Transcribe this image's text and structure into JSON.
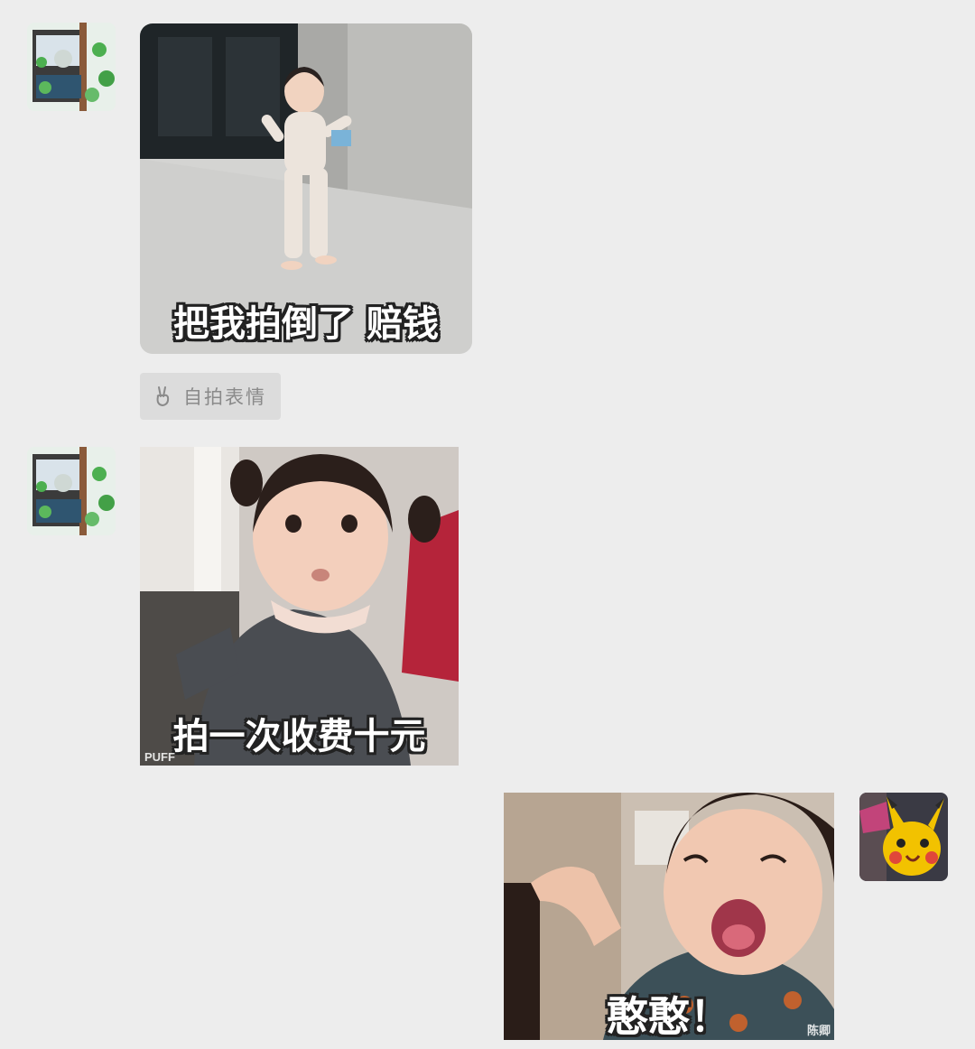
{
  "messages": [
    {
      "side": "left",
      "caption": "把我拍倒了 赔钱",
      "action_label": "自拍表情"
    },
    {
      "side": "left",
      "caption": "拍一次收费十元",
      "watermark": "PUFF"
    },
    {
      "side": "right",
      "caption": "憨憨！",
      "watermark": "陈卿"
    }
  ],
  "icons": {
    "selfie_action": "peace-hand-icon"
  },
  "colors": {
    "background": "#ededed",
    "action_chip": "#dcdcdc",
    "action_text": "#8a8a8a"
  }
}
